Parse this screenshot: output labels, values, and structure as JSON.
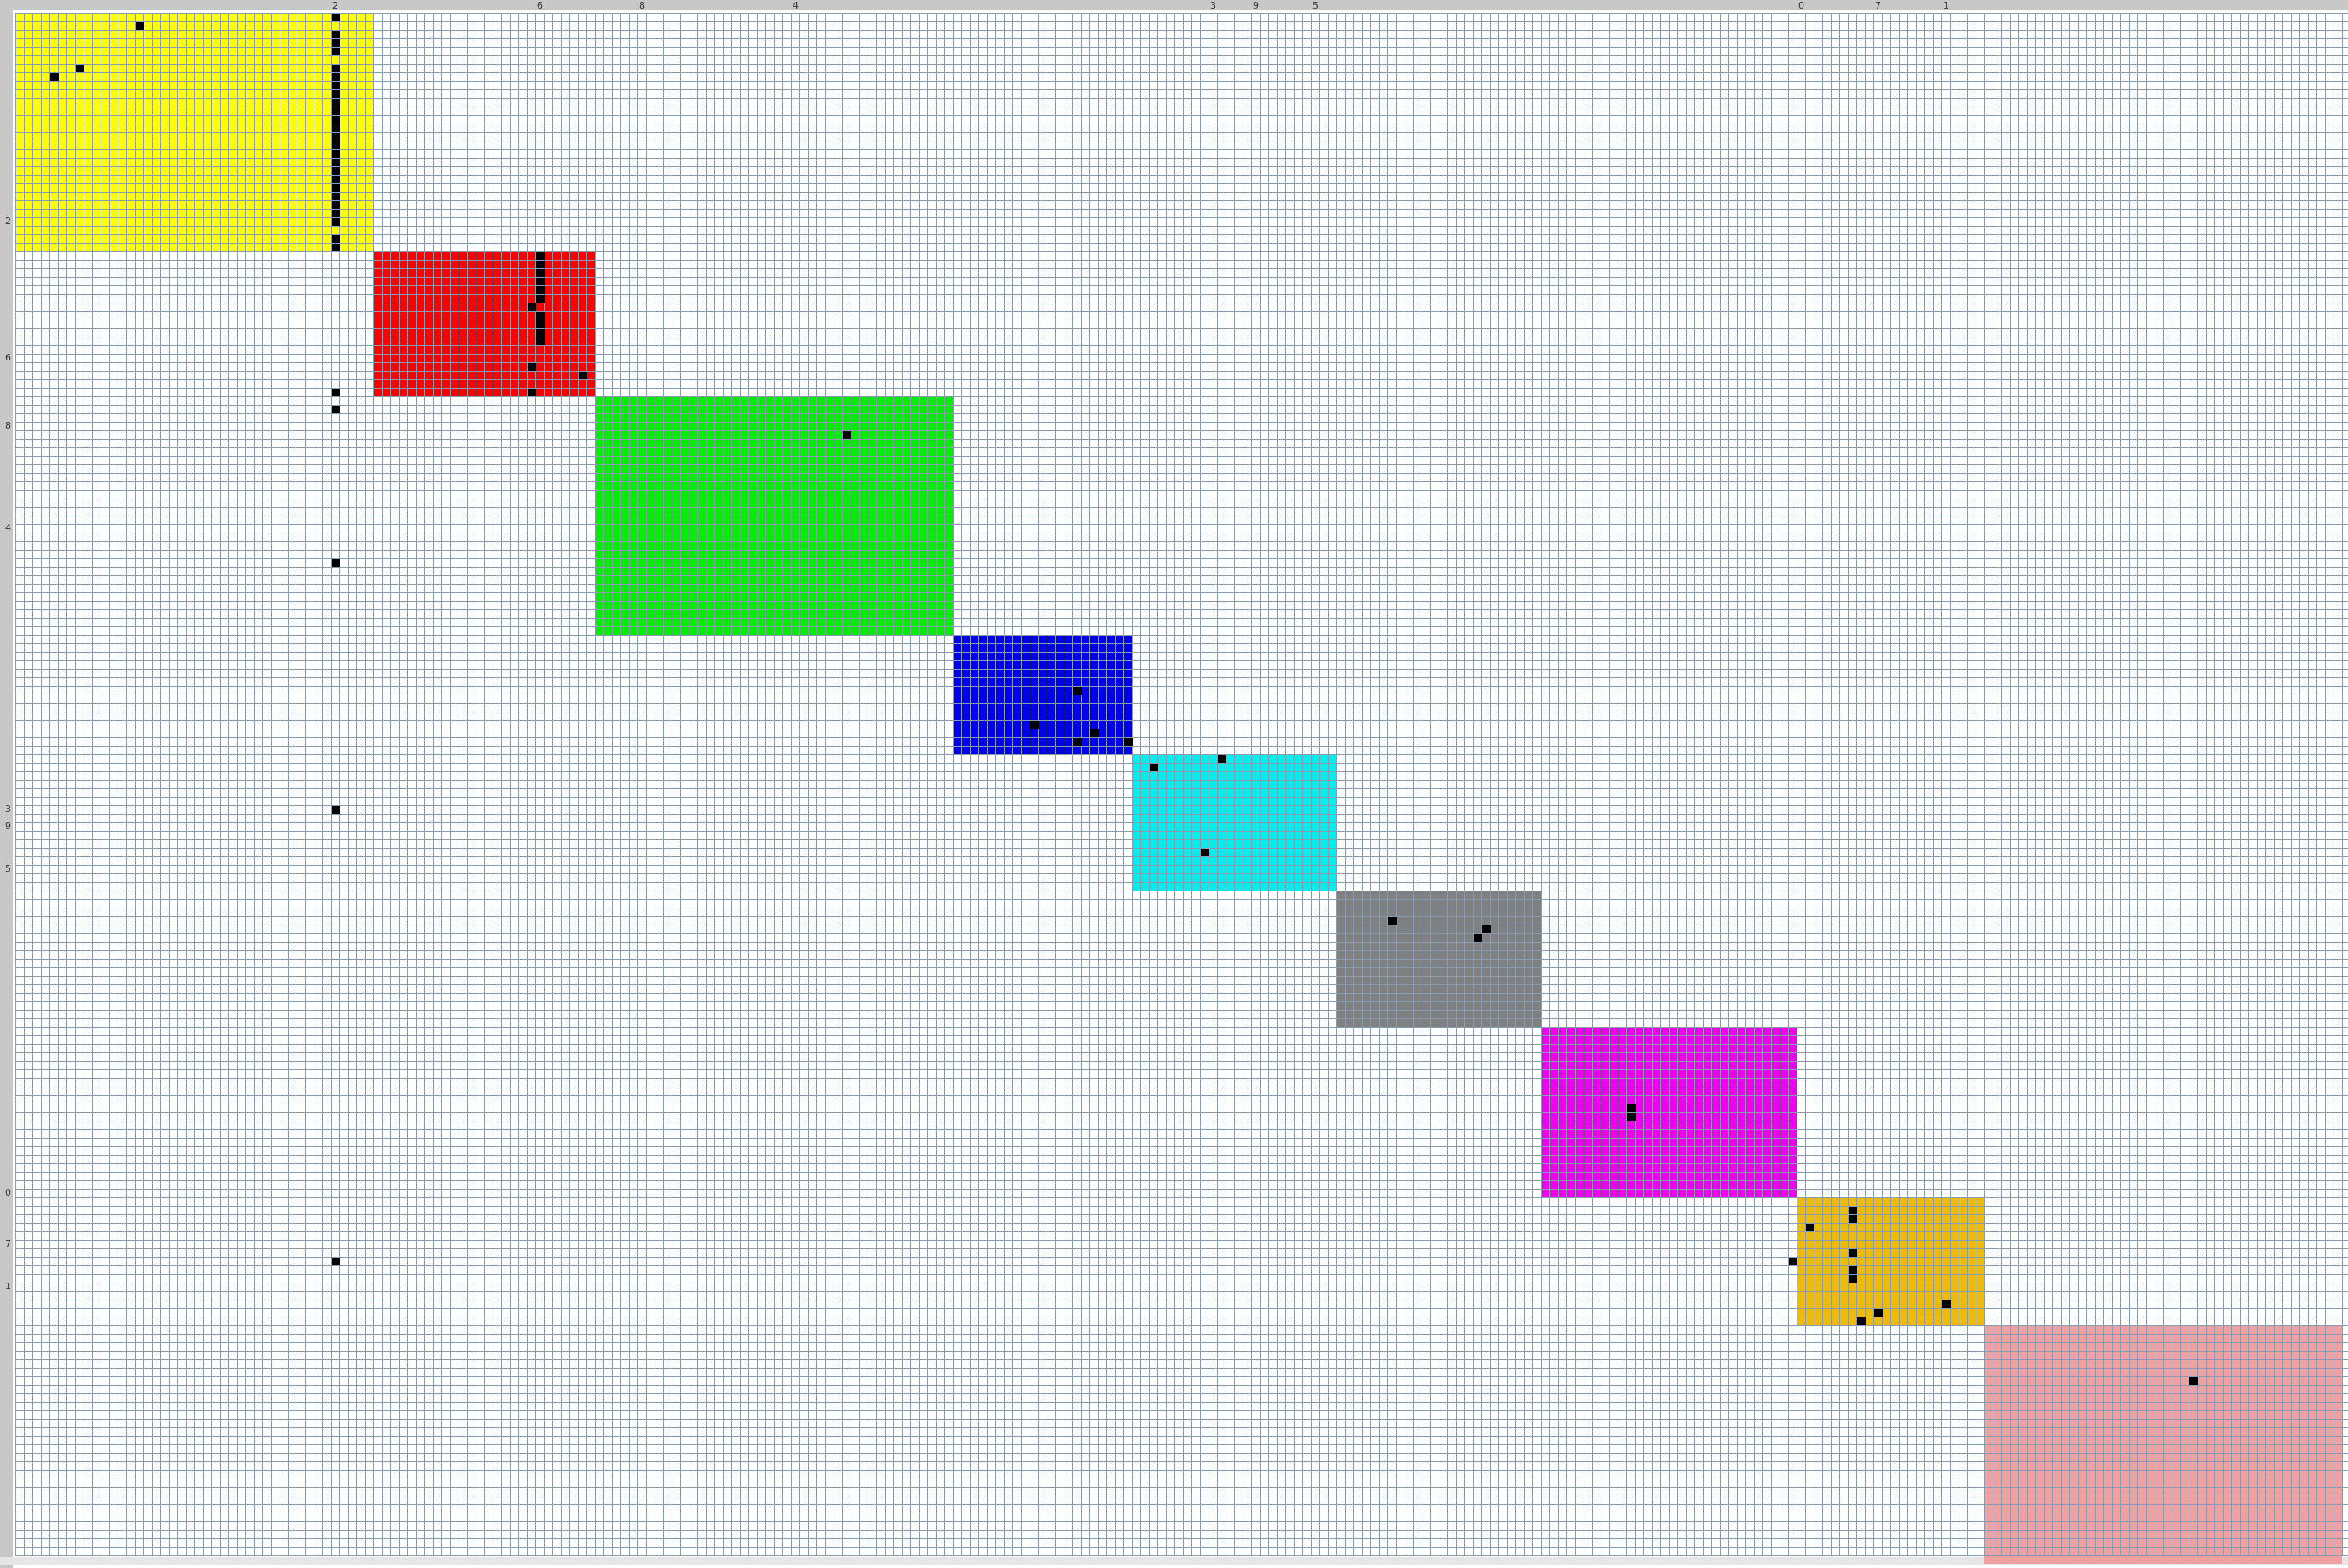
{
  "grid": {
    "cols": 275,
    "rows": 181,
    "background": "#ffffff",
    "line_color": "#8a9bb0",
    "border_color": "#c8c8c8",
    "cell_color": "#000000"
  },
  "blocks": [
    {
      "name": "block-yellow",
      "color": "#ffff00",
      "col0": 0,
      "row0": 0,
      "cols": 42,
      "rows": 28
    },
    {
      "name": "block-red",
      "color": "#ff0000",
      "col0": 42,
      "row0": 28,
      "cols": 26,
      "rows": 17
    },
    {
      "name": "block-green",
      "color": "#00ee00",
      "col0": 68,
      "row0": 45,
      "cols": 42,
      "rows": 28
    },
    {
      "name": "block-blue",
      "color": "#0000ee",
      "col0": 110,
      "row0": 73,
      "cols": 21,
      "rows": 14
    },
    {
      "name": "block-cyan",
      "color": "#00eeee",
      "col0": 131,
      "row0": 87,
      "cols": 24,
      "rows": 16
    },
    {
      "name": "block-gray",
      "color": "#808080",
      "col0": 155,
      "row0": 103,
      "cols": 24,
      "rows": 16
    },
    {
      "name": "block-magenta",
      "color": "#ee00ee",
      "col0": 179,
      "row0": 119,
      "cols": 30,
      "rows": 20
    },
    {
      "name": "block-orange",
      "color": "#eebb00",
      "col0": 209,
      "row0": 139,
      "cols": 22,
      "rows": 15
    },
    {
      "name": "block-pink",
      "color": "#f0a0a0",
      "col0": 231,
      "row0": 154,
      "cols": 42,
      "rows": 28
    }
  ],
  "filled_cells": [
    [
      0,
      37
    ],
    [
      2,
      37
    ],
    [
      3,
      37
    ],
    [
      4,
      37
    ],
    [
      6,
      37
    ],
    [
      7,
      37
    ],
    [
      8,
      37
    ],
    [
      9,
      37
    ],
    [
      10,
      37
    ],
    [
      11,
      37
    ],
    [
      12,
      37
    ],
    [
      13,
      37
    ],
    [
      14,
      37
    ],
    [
      15,
      37
    ],
    [
      16,
      37
    ],
    [
      17,
      37
    ],
    [
      18,
      37
    ],
    [
      19,
      37
    ],
    [
      20,
      37
    ],
    [
      21,
      37
    ],
    [
      22,
      37
    ],
    [
      23,
      37
    ],
    [
      24,
      37
    ],
    [
      26,
      37
    ],
    [
      27,
      37
    ],
    [
      1,
      14
    ],
    [
      6,
      7
    ],
    [
      7,
      4
    ],
    [
      28,
      61
    ],
    [
      29,
      61
    ],
    [
      30,
      61
    ],
    [
      31,
      61
    ],
    [
      32,
      61
    ],
    [
      33,
      61
    ],
    [
      34,
      60
    ],
    [
      35,
      61
    ],
    [
      36,
      61
    ],
    [
      37,
      61
    ],
    [
      38,
      61
    ],
    [
      41,
      60
    ],
    [
      42,
      66
    ],
    [
      44,
      37
    ],
    [
      44,
      60
    ],
    [
      46,
      37
    ],
    [
      49,
      97
    ],
    [
      64,
      37
    ],
    [
      79,
      124
    ],
    [
      83,
      119
    ],
    [
      84,
      126
    ],
    [
      85,
      124
    ],
    [
      85,
      130
    ],
    [
      87,
      141
    ],
    [
      88,
      133
    ],
    [
      98,
      139
    ],
    [
      106,
      161
    ],
    [
      107,
      172
    ],
    [
      108,
      171
    ],
    [
      128,
      189
    ],
    [
      129,
      189
    ],
    [
      140,
      215
    ],
    [
      141,
      215
    ],
    [
      142,
      210
    ],
    [
      145,
      215
    ],
    [
      146,
      208
    ],
    [
      147,
      215
    ],
    [
      148,
      215
    ],
    [
      151,
      226
    ],
    [
      152,
      218
    ],
    [
      153,
      216
    ],
    [
      93,
      37
    ],
    [
      146,
      37
    ],
    [
      160,
      255
    ]
  ],
  "top_labels": [
    {
      "col": 37,
      "text": "2"
    },
    {
      "col": 61,
      "text": "6"
    },
    {
      "col": 73,
      "text": "8"
    },
    {
      "col": 91,
      "text": "4"
    },
    {
      "col": 140,
      "text": "3"
    },
    {
      "col": 145,
      "text": "9"
    },
    {
      "col": 152,
      "text": "5"
    },
    {
      "col": 209,
      "text": "0"
    },
    {
      "col": 218,
      "text": "7"
    },
    {
      "col": 226,
      "text": "1"
    }
  ],
  "left_labels": [
    {
      "row": 24,
      "text": "2"
    },
    {
      "row": 40,
      "text": "6"
    },
    {
      "row": 48,
      "text": "8"
    },
    {
      "row": 60,
      "text": "4"
    },
    {
      "row": 93,
      "text": "3"
    },
    {
      "row": 95,
      "text": "9"
    },
    {
      "row": 100,
      "text": "5"
    },
    {
      "row": 138,
      "text": "0"
    },
    {
      "row": 144,
      "text": "7"
    },
    {
      "row": 149,
      "text": "1"
    }
  ]
}
